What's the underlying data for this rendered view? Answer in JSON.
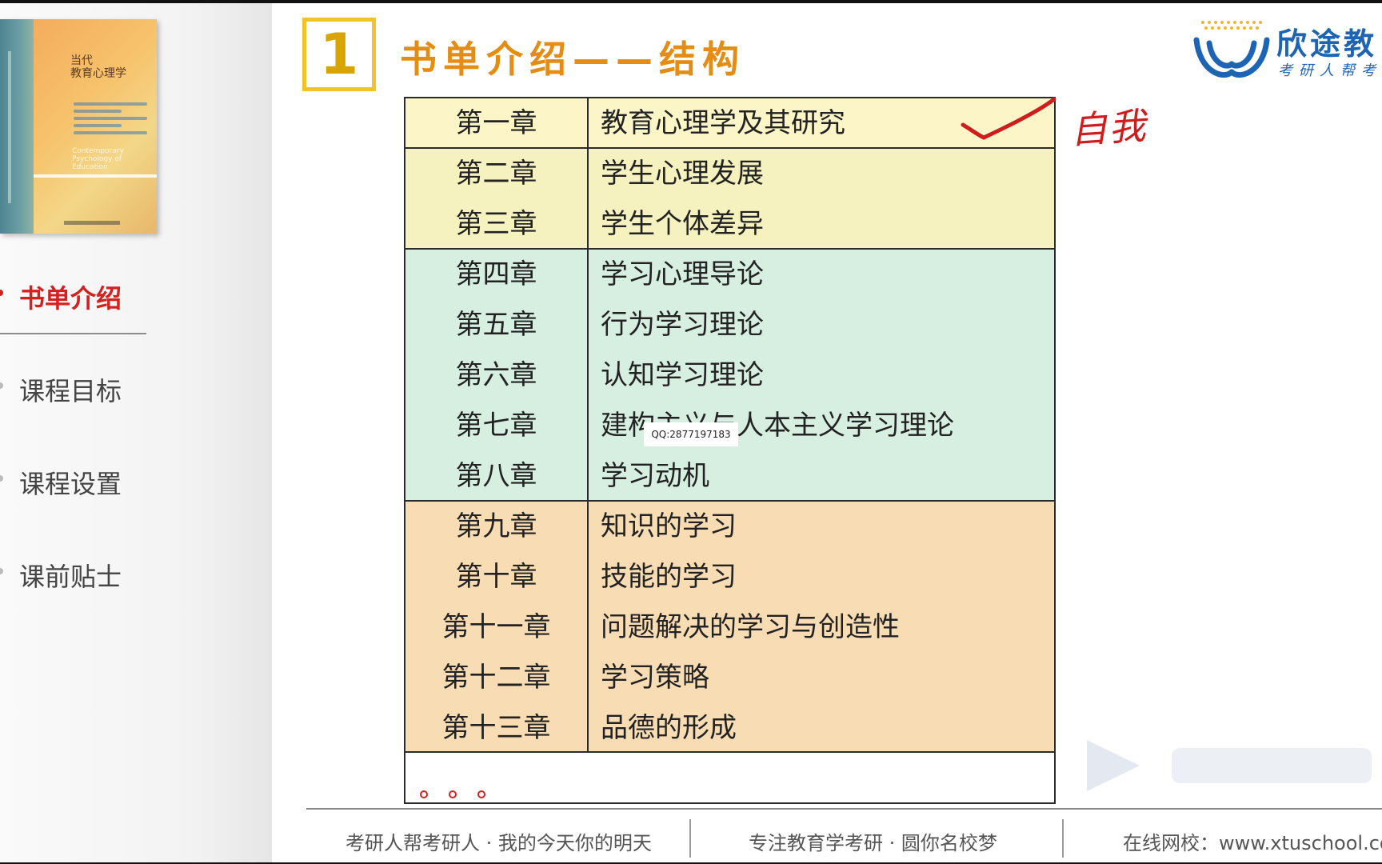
{
  "sidebar": {
    "book": {
      "title_line1": "当代",
      "title_line2": "教育心理学",
      "english": "Contemporary Psychology of Education"
    },
    "nav": [
      {
        "label": "书单介绍",
        "active": true
      },
      {
        "label": "课程目标",
        "active": false
      },
      {
        "label": "课程设置",
        "active": false
      },
      {
        "label": "课前贴士",
        "active": false
      }
    ]
  },
  "header": {
    "section_number": "1",
    "title": "书单介绍——结构"
  },
  "logo": {
    "name": "欣途教",
    "slogan": "考研人帮考"
  },
  "table": {
    "rows": [
      {
        "chapter": "第一章",
        "title": "教育心理学及其研究"
      },
      {
        "chapter": "第二章",
        "title": "学生心理发展"
      },
      {
        "chapter": "第三章",
        "title": "学生个体差异"
      },
      {
        "chapter": "第四章",
        "title": "学习心理导论"
      },
      {
        "chapter": "第五章",
        "title": "行为学习理论"
      },
      {
        "chapter": "第六章",
        "title": "认知学习理论"
      },
      {
        "chapter": "第七章",
        "title": "建构主义与人本主义学习理论"
      },
      {
        "chapter": "第八章",
        "title": "学习动机"
      },
      {
        "chapter": "第九章",
        "title": "知识的学习"
      },
      {
        "chapter": "第十章",
        "title": "技能的学习"
      },
      {
        "chapter": "第十一章",
        "title": "问题解决的学习与创造性"
      },
      {
        "chapter": "第十二章",
        "title": "学习策略"
      },
      {
        "chapter": "第十三章",
        "title": "品德的形成"
      }
    ],
    "band_colors": {
      "yellow": "#fbf5c8",
      "green": "#d6efe0",
      "orange": "#f8dcb4"
    }
  },
  "overlay": {
    "qq": "QQ:2877197183",
    "handwritten_note": "自我"
  },
  "footer": {
    "left": "考研人帮考研人 · 我的今天你的明天",
    "middle": "专注教育学考研 · 圆你名校梦",
    "right": "在线网校：www.xtuschool.co"
  },
  "colors": {
    "title_orange": "#e58c14",
    "number_gold": "#f4c22a",
    "active_red": "#d4201f",
    "logo_blue": "#1e64b4"
  }
}
